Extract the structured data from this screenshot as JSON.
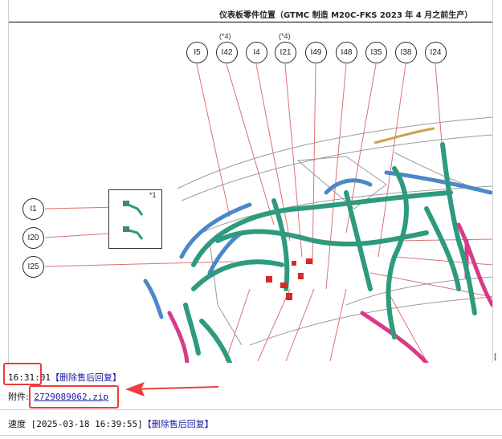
{
  "diagram": {
    "title": "仪表板零件位置（GTMC 制造 M20C-FKS 2023 年 4 月之前生产）",
    "top_callouts": [
      "I5",
      "I42",
      "I4",
      "I21",
      "I49",
      "I48",
      "I35",
      "I38",
      "I24"
    ],
    "star_notes": [
      "(*4)",
      "(*4)"
    ],
    "left_callouts": [
      "I1",
      "I20",
      "I25"
    ],
    "inset_note": "*1",
    "crop_mark": "["
  },
  "posts": [
    {
      "time": "16:31:01",
      "delete_link": "【删除售后回复】"
    }
  ],
  "attachment": {
    "label": "附件:",
    "filename": "2729089062.zip"
  },
  "next_post": {
    "author": "速度",
    "timestamp": "[2025-03-18 16:39:55]",
    "delete_link": "【删除售后回复】"
  },
  "colors": {
    "highlight": "#ee3b3b",
    "link": "#1a1aa6",
    "harness_green": "#2e9a7e",
    "harness_pink": "#d83a8a",
    "harness_blue": "#4b88c8",
    "leader_line": "#e07070"
  }
}
